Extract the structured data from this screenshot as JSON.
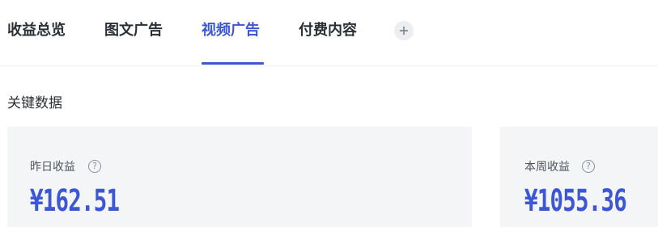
{
  "tabs": [
    {
      "label": "收益总览",
      "active": false
    },
    {
      "label": "图文广告",
      "active": false
    },
    {
      "label": "视频广告",
      "active": true
    },
    {
      "label": "付费内容",
      "active": false
    }
  ],
  "add_tab_symbol": "+",
  "section_title": "关键数据",
  "cards": [
    {
      "label": "昨日收益",
      "help_symbol": "?",
      "value": "¥162.51"
    },
    {
      "label": "本周收益",
      "help_symbol": "?",
      "value": "¥1055.36"
    }
  ],
  "colors": {
    "accent": "#3b57d6",
    "card_background": "#f4f5f7",
    "text_primary": "#2b2f36"
  }
}
